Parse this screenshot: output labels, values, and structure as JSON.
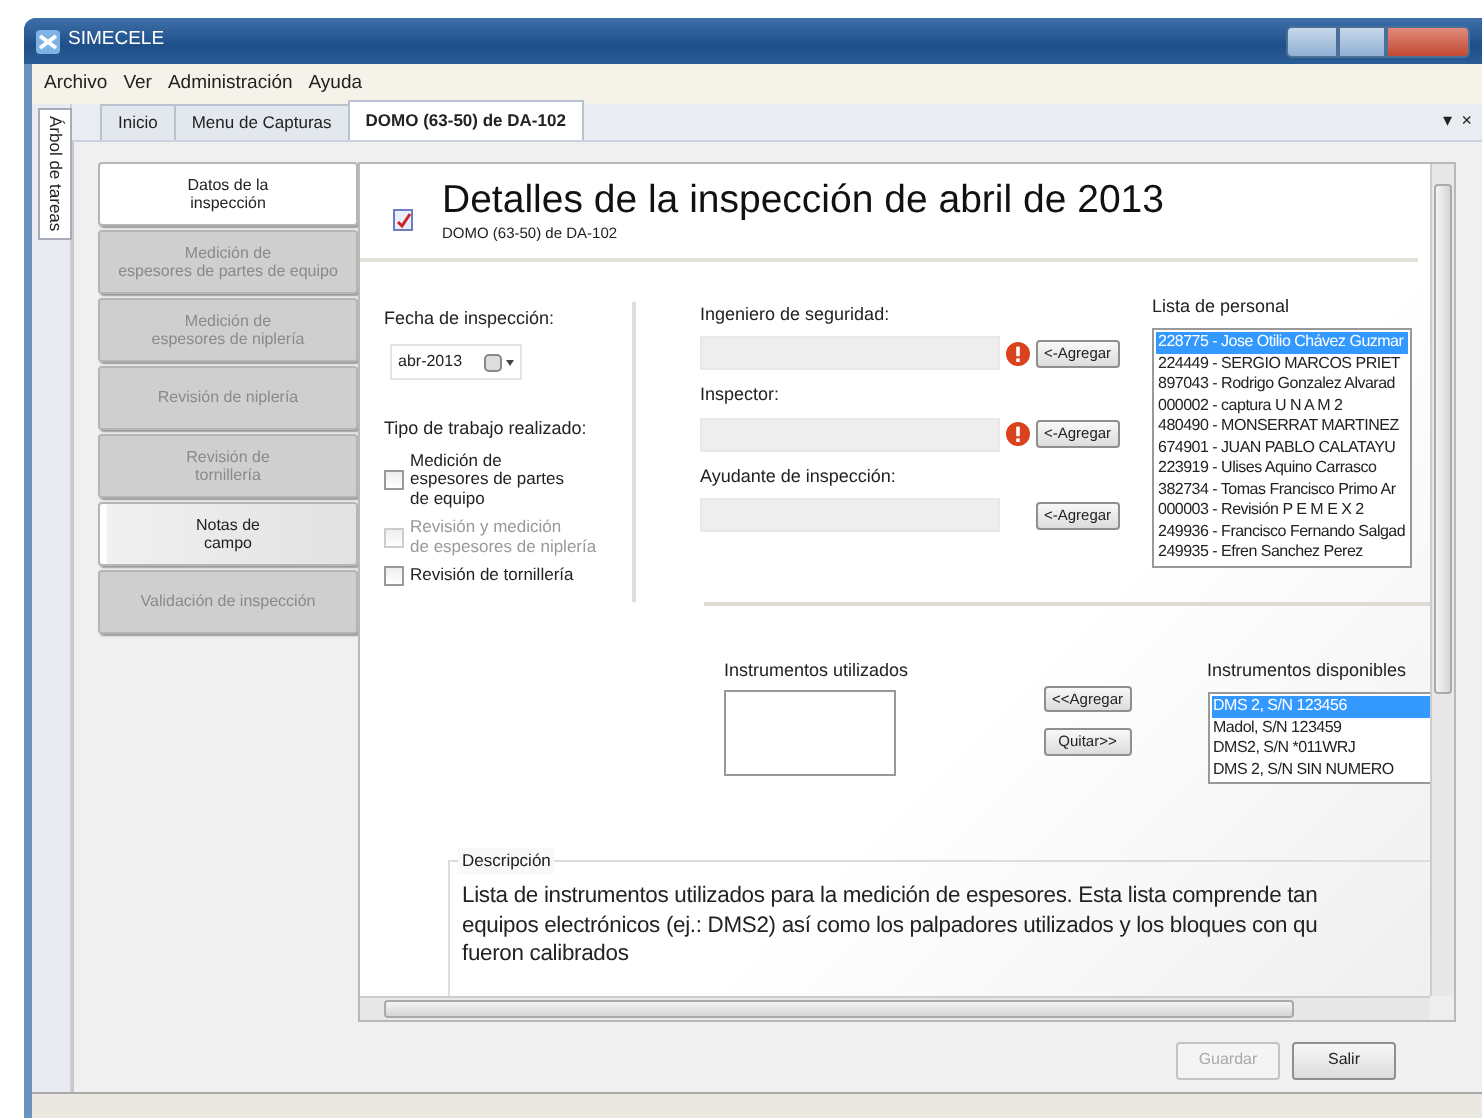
{
  "window": {
    "title": "SIMECELE"
  },
  "menu": [
    "Archivo",
    "Ver",
    "Administración",
    "Ayuda"
  ],
  "side_panel": {
    "label": "Árbol de tareas"
  },
  "tabs": [
    {
      "label": "Inicio",
      "selected": false
    },
    {
      "label": "Menu  de Capturas",
      "selected": false
    },
    {
      "label": "DOMO (63-50) de DA-102",
      "selected": true
    }
  ],
  "pane_controls": [
    "▾",
    "×"
  ],
  "nav": [
    {
      "label": "Datos de la\ninspección",
      "selected": true,
      "disabled": false
    },
    {
      "label": "Medición de\nespesores de partes de equipo",
      "selected": false,
      "disabled": true
    },
    {
      "label": "Medición de\nespesores de niplería",
      "selected": false,
      "disabled": true
    },
    {
      "label": "Revisión de niplería",
      "selected": false,
      "disabled": true
    },
    {
      "label": "Revisión de\ntornillería",
      "selected": false,
      "disabled": true
    },
    {
      "label": "Notas de\ncampo",
      "selected": false,
      "disabled": false
    },
    {
      "label": "Validación de inspección",
      "selected": false,
      "disabled": true
    }
  ],
  "header": {
    "title": "Detalles de la inspección de abril de 2013",
    "subtitle": "DOMO (63-50) de DA-102"
  },
  "date": {
    "label": "Fecha de inspección:",
    "value": "abr-2013"
  },
  "work_type": {
    "label": "Tipo de trabajo realizado:",
    "options": [
      {
        "label": "Medición de\nespesores de partes\nde equipo",
        "checked": false,
        "disabled": false
      },
      {
        "label": "Revisión y medición\nde espesores de niplería",
        "checked": false,
        "disabled": true
      },
      {
        "label": "Revisión de tornillería",
        "checked": false,
        "disabled": false
      }
    ]
  },
  "people_fields": [
    {
      "label": "Ingeniero de seguridad:",
      "button": "<-Agregar",
      "error": true
    },
    {
      "label": "Inspector:",
      "button": "<-Agregar",
      "error": true
    },
    {
      "label": "Ayudante de inspección:",
      "button": "<-Agregar",
      "error": false
    }
  ],
  "personnel": {
    "label": "Lista de personal",
    "items": [
      {
        "text": "228775 - Jose Otilio Chávez Guzmar",
        "selected": true
      },
      {
        "text": "224449 - SERGIO MARCOS PRIET",
        "selected": false
      },
      {
        "text": "897043 - Rodrigo Gonzalez Alvarad",
        "selected": false
      },
      {
        "text": "000002 - captura U N A M 2",
        "selected": false
      },
      {
        "text": "480490 - MONSERRAT MARTINEZ",
        "selected": false
      },
      {
        "text": "674901 - JUAN PABLO CALATAYU",
        "selected": false
      },
      {
        "text": "223919 - Ulises Aquino Carrasco",
        "selected": false
      },
      {
        "text": "382734 - Tomas Francisco Primo Ar",
        "selected": false
      },
      {
        "text": "000003 - Revisión P E M E X 2",
        "selected": false
      },
      {
        "text": "249936 - Francisco Fernando Salgad",
        "selected": false
      },
      {
        "text": "249935 - Efren Sanchez Perez",
        "selected": false
      }
    ]
  },
  "instruments": {
    "used_label": "Instrumentos utilizados",
    "add_button": "<<Agregar",
    "remove_button": "Quitar>>",
    "available_label": "Instrumentos disponibles",
    "available": [
      {
        "text": "DMS 2, S/N 123456",
        "selected": true
      },
      {
        "text": "Madol, S/N 123459",
        "selected": false
      },
      {
        "text": "DMS2, S/N *011WRJ",
        "selected": false
      },
      {
        "text": "DMS 2, S/N SIN NUMERO",
        "selected": false
      }
    ]
  },
  "description": {
    "legend": "Descripción",
    "text": "Lista de instrumentos utilizados para la medición de espesores. Esta lista comprende tan\nequipos electrónicos (ej.: DMS2) así como los palpadores utilizados y los bloques con qu\nfueron calibrados"
  },
  "buttons": [
    {
      "label": "Guardar",
      "disabled": true
    },
    {
      "label": "Salir",
      "disabled": false
    }
  ]
}
